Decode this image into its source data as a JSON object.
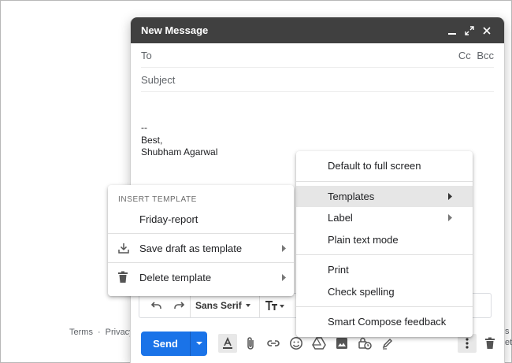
{
  "footer": {
    "links": [
      "Terms",
      "·",
      "Privacy",
      "·"
    ],
    "right_text_1": "s a",
    "right_text_2": "eta"
  },
  "compose": {
    "title": "New Message",
    "to_label": "To",
    "cc_label": "Cc",
    "bcc_label": "Bcc",
    "subject_placeholder": "Subject",
    "signature": [
      "--",
      "Best,",
      "Shubham Agarwal"
    ],
    "send_label": "Send",
    "font_name": "Sans Serif"
  },
  "main_menu": {
    "items": [
      {
        "label": "Default to full screen"
      },
      {
        "label": "Templates",
        "has_submenu": true,
        "active": true
      },
      {
        "label": "Label",
        "has_submenu": true
      },
      {
        "label": "Plain text mode"
      },
      {
        "label": "Print"
      },
      {
        "label": "Check spelling"
      },
      {
        "label": "Smart Compose feedback"
      }
    ]
  },
  "templates_menu": {
    "heading": "INSERT TEMPLATE",
    "template": "Friday-report",
    "save_label": "Save draft as template",
    "delete_label": "Delete template"
  },
  "colors": {
    "header_bg": "#404040",
    "send_blue": "#1a73e8",
    "active_item": "#e6e6e6"
  }
}
